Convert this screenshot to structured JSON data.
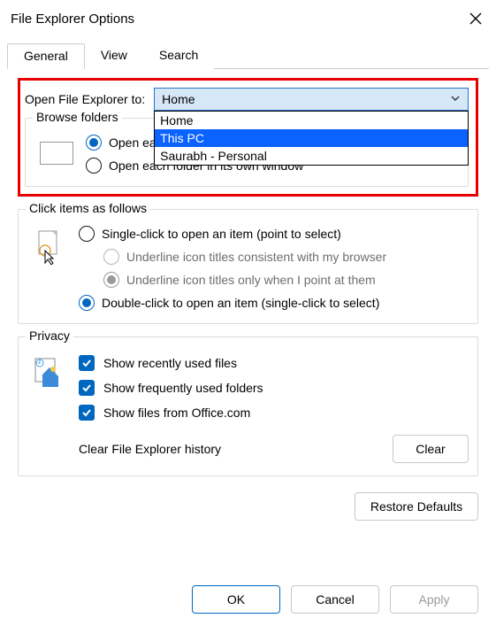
{
  "window": {
    "title": "File Explorer Options"
  },
  "tabs": {
    "general": "General",
    "view": "View",
    "search": "Search"
  },
  "open_to": {
    "label": "Open File Explorer to:",
    "selected": "Home",
    "options": [
      "Home",
      "This PC",
      "Saurabh - Personal"
    ],
    "highlighted_index": 1
  },
  "browse": {
    "legend": "Browse folders",
    "same_window": "Open each folder in the same window",
    "own_window": "Open each folder in its own window"
  },
  "click": {
    "legend": "Click items as follows",
    "single": "Single-click to open an item (point to select)",
    "underline_browser": "Underline icon titles consistent with my browser",
    "underline_point": "Underline icon titles only when I point at them",
    "double": "Double-click to open an item (single-click to select)"
  },
  "privacy": {
    "legend": "Privacy",
    "recent": "Show recently used files",
    "frequent": "Show frequently used folders",
    "office": "Show files from Office.com",
    "clear_label": "Clear File Explorer history",
    "clear_btn": "Clear"
  },
  "buttons": {
    "restore": "Restore Defaults",
    "ok": "OK",
    "cancel": "Cancel",
    "apply": "Apply"
  }
}
